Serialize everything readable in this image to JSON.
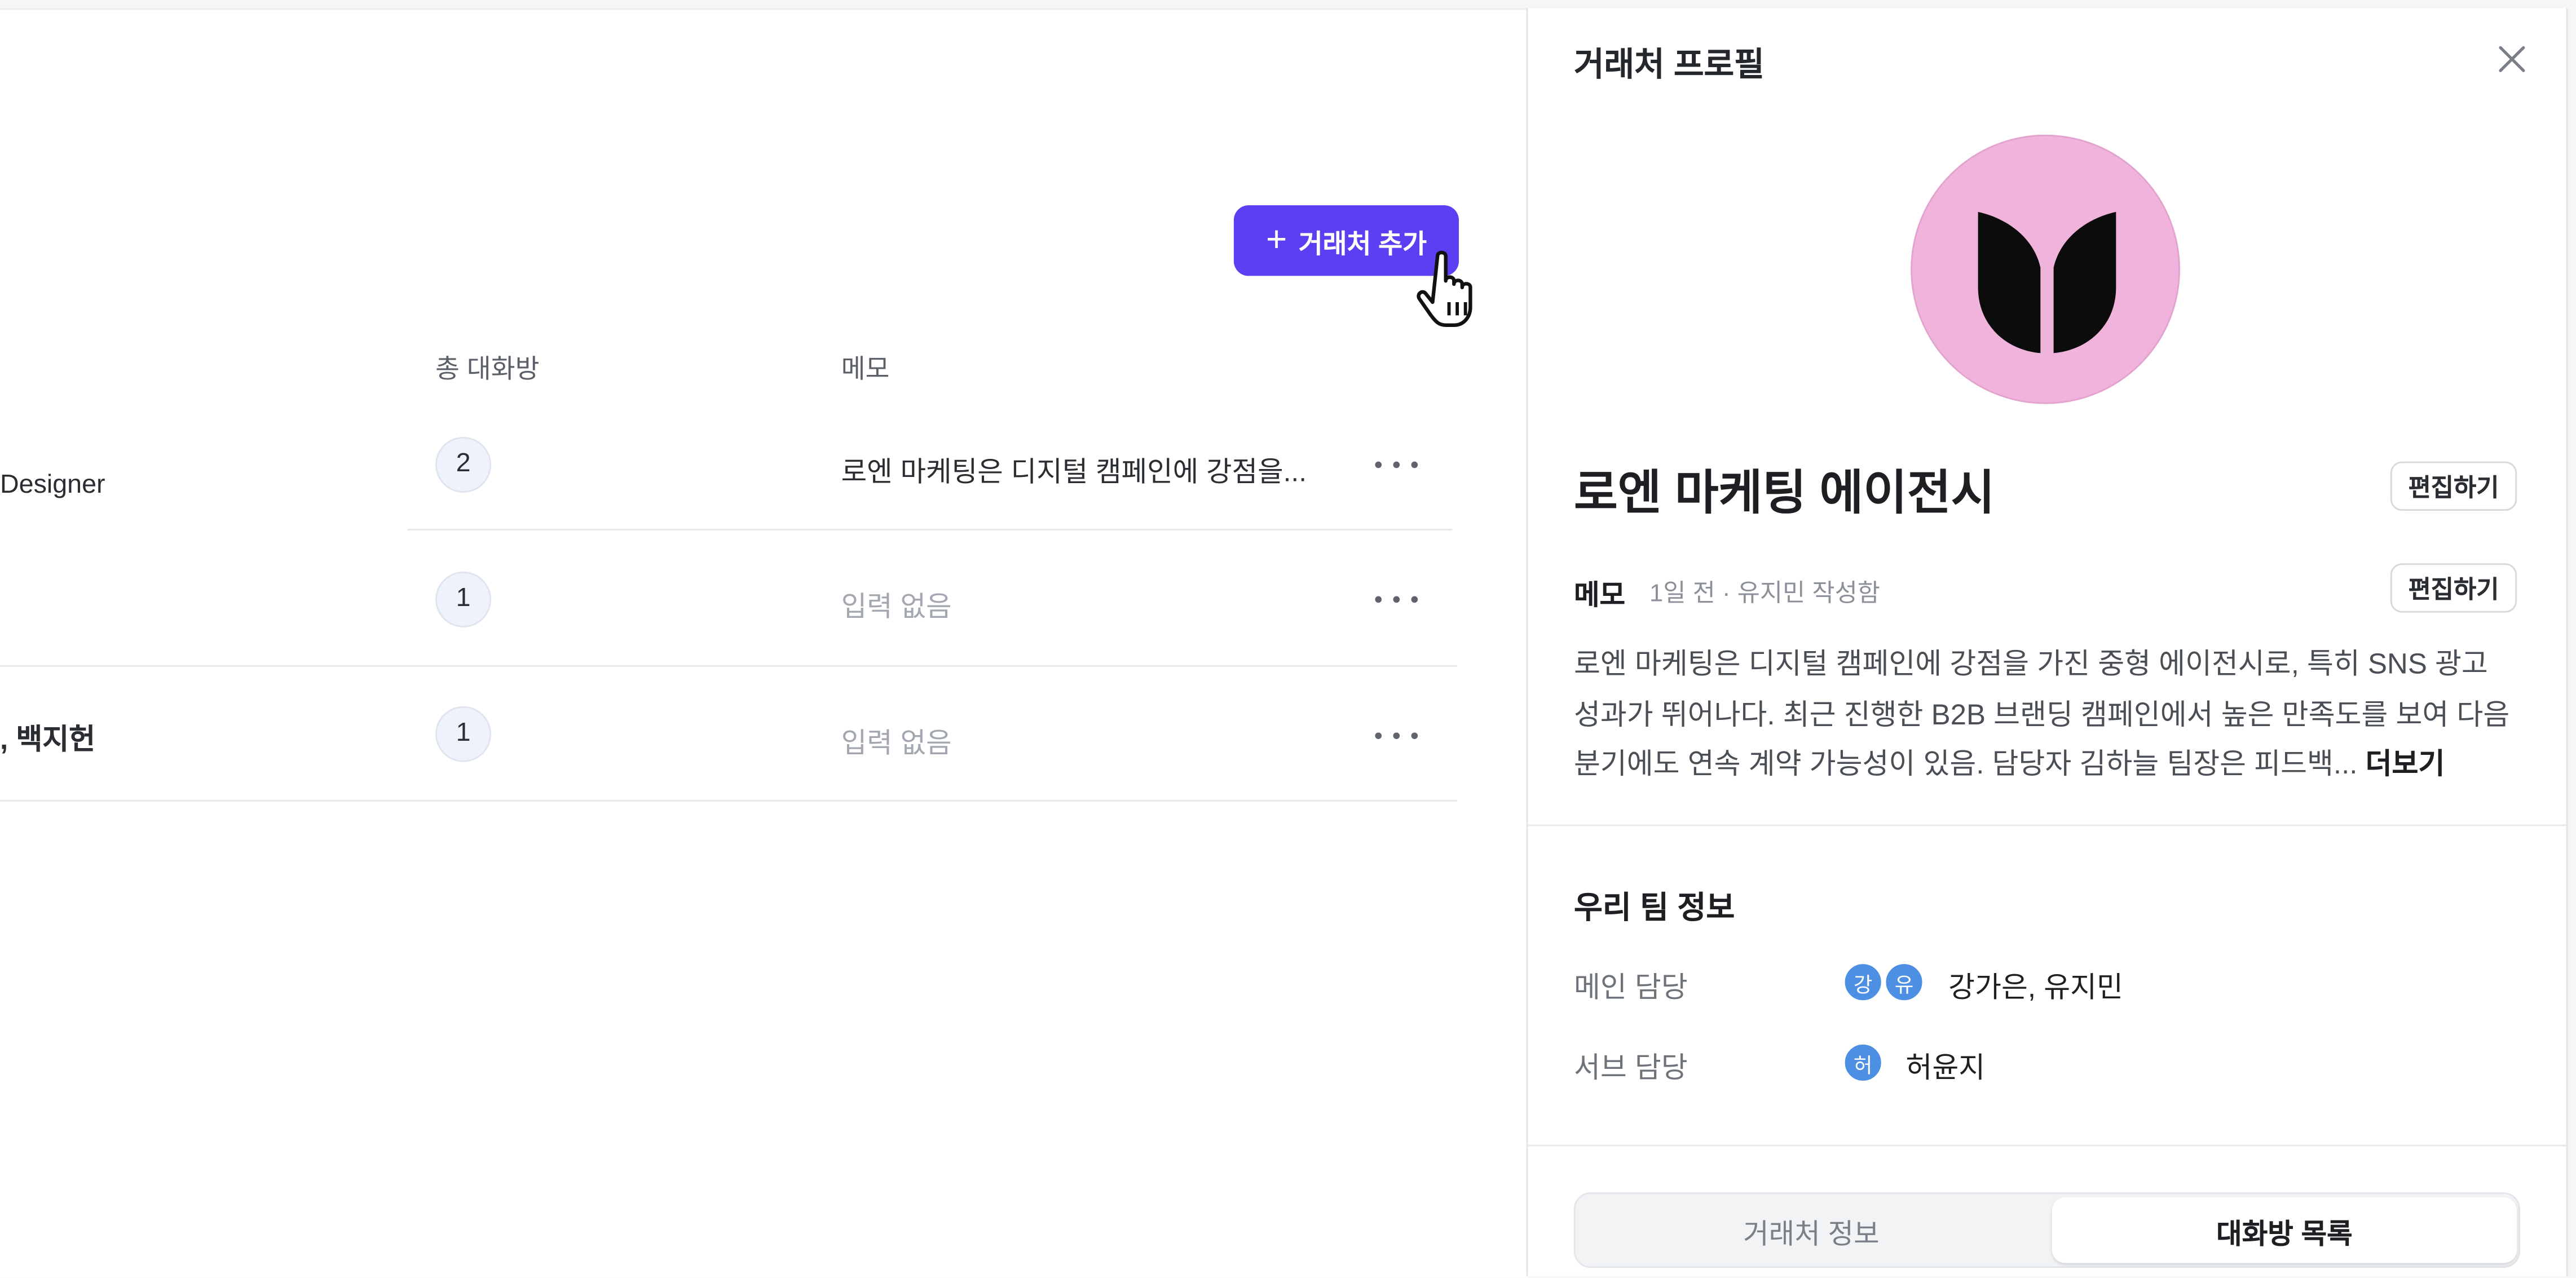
{
  "toolbar": {
    "add_label": "거래처 추가",
    "add_icon": "plus-icon"
  },
  "table": {
    "columns": [
      "총 대화방",
      "메모"
    ],
    "rows": [
      {
        "left_text": "Designer",
        "count": "2",
        "memo": "로엔 마케팅은 디지털 캠페인에 강점을...",
        "memo_empty": false
      },
      {
        "left_text": "",
        "count": "1",
        "memo": "입력 없음",
        "memo_empty": true
      },
      {
        "left_text": ", 백지헌",
        "count": "1",
        "memo": "입력 없음",
        "memo_empty": true
      }
    ]
  },
  "panel": {
    "title": "거래처 프로필",
    "company_name": "로엔 마케팅 에이전시",
    "edit_label": "편집하기",
    "memo": {
      "label": "메모",
      "meta": "1일 전 · 유지민 작성함",
      "edit_label": "편집하기",
      "body": "로엔 마케팅은 디지털 캠페인에 강점을 가진 중형 에이전시로, 특히 SNS 광고 성과가 뛰어나다. 최근 진행한 B2B 브랜딩 캠페인에서 높은 만족도를 보여 다음 분기에도 연속 계약 가능성이 있음. 담당자 김하늘 팀장은 피드백...",
      "more_label": "더보기"
    },
    "team": {
      "title": "우리 팀 정보",
      "main_label": "메인 담당",
      "main_avatars": [
        "강",
        "유"
      ],
      "main_value": "강가은, 유지민",
      "sub_label": "서브 담당",
      "sub_avatars": [
        "허"
      ],
      "sub_value": "허윤지"
    },
    "tabs": [
      {
        "label": "거래처 정보",
        "active": false
      },
      {
        "label": "대화방 목록",
        "active": true
      }
    ]
  },
  "colors": {
    "accent": "#5b3ff2",
    "logo_background": "#f0b4dc",
    "avatar": "#4d8fe3"
  }
}
